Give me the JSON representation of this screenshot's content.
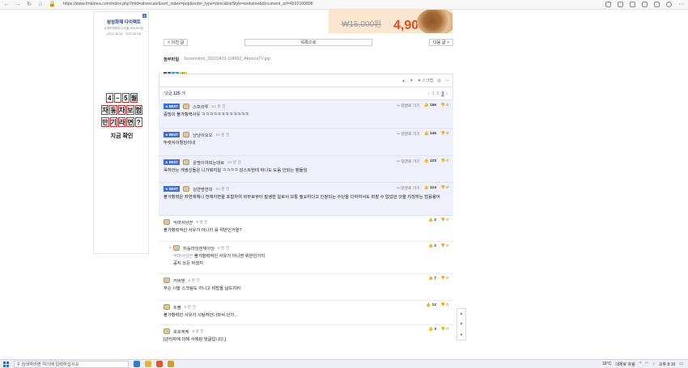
{
  "browser": {
    "url": "https://www.fmkorea.com/index.php?mid=afreecatv&sort_index=pop&order_type=desc&listStyle=webzine&document_srl=4512100898"
  },
  "left_ad": {
    "brand": "삼성화재 다이렉트",
    "line1": "손해보험협회 심의필 제41519호",
    "line2": "(2021.08.04 ~ 2022.08.03)",
    "row1": [
      "4",
      "~",
      "5",
      "월"
    ],
    "row2": [
      "자",
      "동",
      "차",
      "보",
      "험"
    ],
    "row3": [
      "만",
      "기",
      "라",
      "면",
      "?"
    ],
    "cta": "지금 확인",
    "close": "X"
  },
  "banner": {
    "old_price": "₩15,000원",
    "new_price": "4,900원"
  },
  "post": {
    "prev_label": "< 이전 글",
    "list_label": "목록으로",
    "next_label": "다음 글 >",
    "file_label": "첨부파일",
    "file_name": "Screenshot_20220410-194902_AfreecaTV.jpg"
  },
  "comments_toolbar": {
    "scrap": "스크랩"
  },
  "comments_header": {
    "count_label": "댓글",
    "count": "125",
    "count_suffix": "개",
    "pages": [
      "1",
      "2",
      "3"
    ],
    "current_page": "3"
  },
  "best_comments": [
    {
      "badge": "★ BEST",
      "nick": "스프라투",
      "time": "24 분 전",
      "body": "증빙이 불가항력사유 ㅋㅋㅋㅋㅋㅋㅋㅋㅋㅋㅋㅋ",
      "reply": "댓글로 가기",
      "up": "156",
      "down": "0"
    },
    {
      "badge": "★ BEST",
      "nick": "냥냥이오오",
      "time": "24 분 전",
      "body": "뚜렷식이렇잉이네",
      "reply": "댓글로 가기",
      "up": "146",
      "down": "0"
    },
    {
      "badge": "★ BEST",
      "nick": "운명이여피는데로",
      "time": "22 분 전",
      "body": "꼭하라는 개쌍신들은 니가뭐지일 ㅋㅋㅋㅋ 감스트한테 하나도 도움 안되는 팬들임",
      "reply": "댓글로 가기",
      "up": "123",
      "down": "0"
    },
    {
      "badge": "★ BEST",
      "nick": "김연명연대",
      "time": "23 분 전",
      "body": "불가항력은 자연재해나 전재지변을 포함하여 외부로부터 발생한 일로서 보통 필요하다고 인정되는 수단을 다하여서도 피할 수 없었던 것을 지칭하는 법률용어",
      "reply": "댓글로 가기",
      "up": "124",
      "down": "0"
    }
  ],
  "comments": [
    {
      "nick": "악마사냥꾼",
      "time": "9 분 전",
      "body": "불가항력적인 사유가 아니라 를 위반인거임?",
      "up": "2",
      "down": "0"
    },
    {
      "nick": "저승라잉앤체이엉",
      "time": "8 분 전",
      "quote": "악마사냥꾼",
      "body": "불가항력적인 사유가 아니면 위반인거지",
      "body2": "공지 쓰든 하겠지",
      "up": "2",
      "down": "0",
      "reply": true
    },
    {
      "nick": "커버맨",
      "time": "9 분 전",
      "body": "무슨 시발 스크림도 아니고 비방을 날드지비",
      "up": "7",
      "down": "0"
    },
    {
      "nick": "트볼",
      "time": "9 분 전",
      "body": "불가항력인 사유가 시탕자안나와서 인가...",
      "up": "12",
      "down": "0"
    },
    {
      "nick": "호호케케",
      "time": "8 분 전",
      "body": "[관리자에 의해 삭제된 댓글입니다.]",
      "up": "3",
      "down": "0"
    }
  ],
  "taskbar": {
    "search": "검색하려면 여기에 입력하십시오",
    "temp": "18°C",
    "weather": "대체로 흐림",
    "ampm": "오후",
    "time": "8:16"
  }
}
